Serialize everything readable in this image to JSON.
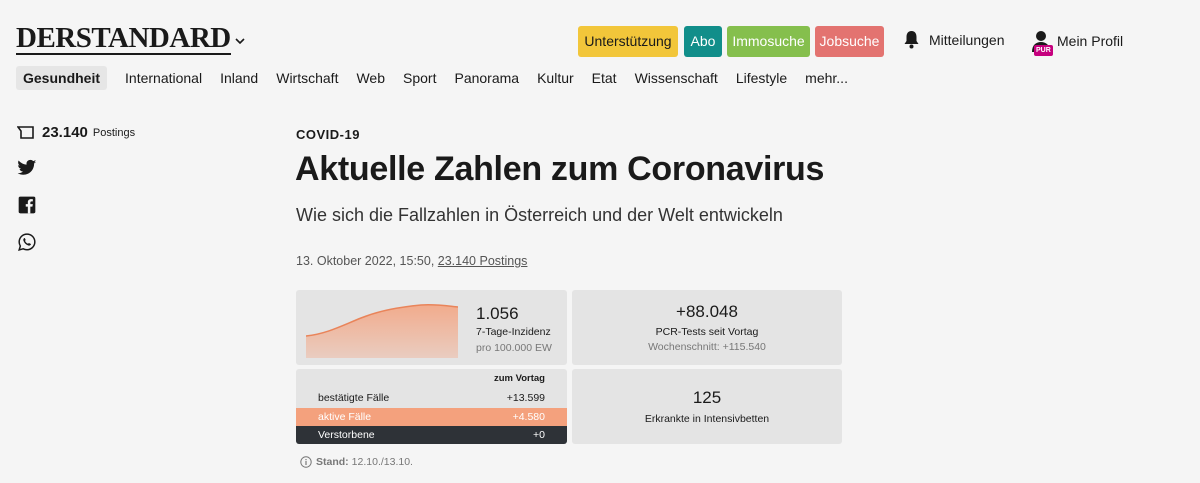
{
  "header": {
    "logo": "DERSTANDARD",
    "pills": {
      "unterstuetzung": "Unterstützung",
      "abo": "Abo",
      "immosuche": "Immosuche",
      "jobsuche": "Jobsuche"
    },
    "notifications": "Mitteilungen",
    "profile": "Mein Profil",
    "profile_badge": "PUR"
  },
  "nav": [
    "Gesundheit",
    "International",
    "Inland",
    "Wirtschaft",
    "Web",
    "Sport",
    "Panorama",
    "Kultur",
    "Etat",
    "Wissenschaft",
    "Lifestyle",
    "mehr..."
  ],
  "rail": {
    "postings_count": "23.140",
    "postings_label": "Postings"
  },
  "article": {
    "kicker": "COVID-19",
    "title": "Aktuelle Zahlen zum Coronavirus",
    "subtitle": "Wie sich die Fallzahlen in Österreich und der Welt entwickeln",
    "meta_date": "13. Oktober 2022, 15:50,",
    "meta_postings": "23.140 Postings"
  },
  "widgets": {
    "inzidenz": {
      "value": "1.056",
      "label": "7-Tage-Inzidenz",
      "sub": "pro 100.000 EW"
    },
    "pcr": {
      "value": "+88.048",
      "label": "PCR-Tests seit Vortag",
      "sub": "Wochenschnitt: +115.540"
    },
    "table": {
      "header": "zum Vortag",
      "rows": [
        {
          "label": "bestätigte Fälle",
          "value": "+13.599"
        },
        {
          "label": "aktive Fälle",
          "value": "+4.580"
        },
        {
          "label": "Verstorbene",
          "value": "+0"
        }
      ]
    },
    "icu": {
      "value": "125",
      "label": "Erkrankte in Intensivbetten"
    },
    "stand": {
      "label": "Stand:",
      "value": "12.10./13.10."
    }
  },
  "colors": {
    "abo": "#118e8a",
    "unterstuetzung": "#f2c63a",
    "immosuche": "#85bf4d",
    "jobsuche": "#e37370",
    "sparkline": "#f4a17d",
    "deaths_row": "#2e3237"
  }
}
